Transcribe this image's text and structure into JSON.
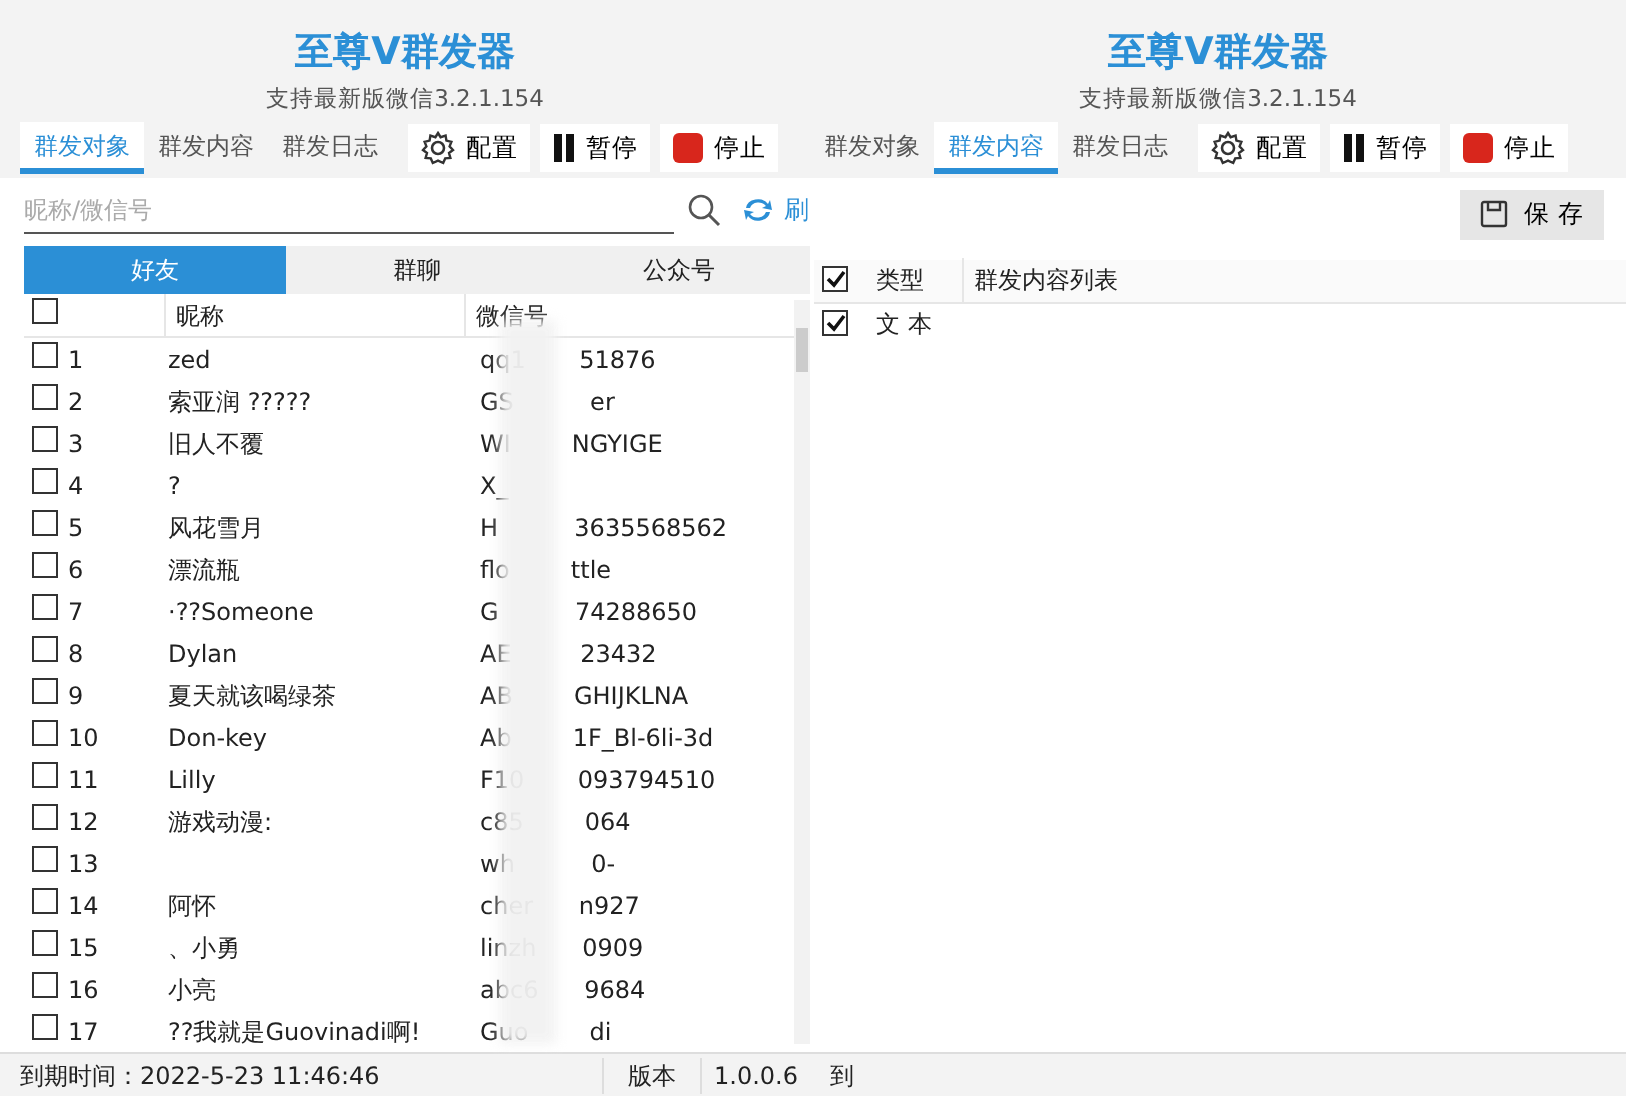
{
  "windows": [
    {
      "title": "至尊V群发器",
      "subtitle": "支持最新版微信3.2.1.154",
      "tabs": [
        {
          "label": "群发对象",
          "selected": true
        },
        {
          "label": "群发内容",
          "selected": false
        },
        {
          "label": "群发日志",
          "selected": false
        }
      ],
      "toolbar": [
        {
          "kind": "gear",
          "label": "配置"
        },
        {
          "kind": "pause",
          "label": "暂停"
        },
        {
          "kind": "stop",
          "label": "停止"
        }
      ],
      "kind": "targets",
      "search": {
        "placeholder": "昵称/微信号",
        "refresh": "刷"
      },
      "segments": [
        {
          "label": "好友",
          "selected": true
        },
        {
          "label": "群聊",
          "selected": false
        },
        {
          "label": "公众号",
          "selected": false
        }
      ],
      "table": {
        "header_checked": false,
        "columns": [
          "昵称",
          "微信号"
        ],
        "rows": [
          {
            "checked": false,
            "index": "1",
            "nickname": "zed",
            "wechat_id": "qq1       51876"
          },
          {
            "checked": false,
            "index": "2",
            "nickname": "索亚润 ?????",
            "wechat_id": "GS          er"
          },
          {
            "checked": false,
            "index": "3",
            "nickname": "旧人不覆",
            "wechat_id": "WI        NGYIGE"
          },
          {
            "checked": false,
            "index": "4",
            "nickname": "?",
            "wechat_id": "X_"
          },
          {
            "checked": false,
            "index": "5",
            "nickname": "风花雪月",
            "wechat_id": "H          3635568562"
          },
          {
            "checked": false,
            "index": "6",
            "nickname": "漂流瓶",
            "wechat_id": "flo        ttle"
          },
          {
            "checked": false,
            "index": "7",
            "nickname": "·??Someone",
            "wechat_id": "G          74288650"
          },
          {
            "checked": false,
            "index": "8",
            "nickname": "Dylan",
            "wechat_id": "AE         23432"
          },
          {
            "checked": false,
            "index": "9",
            "nickname": "夏天就该喝绿茶",
            "wechat_id": "AB        GHIJKLNA"
          },
          {
            "checked": false,
            "index": "10",
            "nickname": "Don-key",
            "wechat_id": "Ab        1F_Bl-6li-3d"
          },
          {
            "checked": false,
            "index": "11",
            "nickname": "Lilly",
            "wechat_id": "F10       093794510"
          },
          {
            "checked": false,
            "index": "12",
            "nickname": "游戏动漫:",
            "wechat_id": "c85        064"
          },
          {
            "checked": false,
            "index": "13",
            "nickname": "",
            "wechat_id": "wh          0-"
          },
          {
            "checked": false,
            "index": "14",
            "nickname": "阿怀",
            "wechat_id": "cher      n927"
          },
          {
            "checked": false,
            "index": "15",
            "nickname": "、小勇",
            "wechat_id": "linzh      0909"
          },
          {
            "checked": false,
            "index": "16",
            "nickname": "小亮",
            "wechat_id": "abc6      9684"
          },
          {
            "checked": false,
            "index": "17",
            "nickname": "??我就是Guovinadi啊!",
            "wechat_id": "Guo        di"
          }
        ]
      },
      "status_bar": {
        "expiry": "到期时间：2022-5-23 11:46:46",
        "version_label": "版本",
        "version": "1.0.0.6"
      }
    },
    {
      "title": "至尊V群发器",
      "subtitle": "支持最新版微信3.2.1.154",
      "tabs": [
        {
          "label": "群发对象",
          "selected": false
        },
        {
          "label": "群发内容",
          "selected": true
        },
        {
          "label": "群发日志",
          "selected": false
        }
      ],
      "toolbar": [
        {
          "kind": "gear",
          "label": "配置"
        },
        {
          "kind": "pause",
          "label": "暂停"
        },
        {
          "kind": "stop",
          "label": "停止"
        }
      ],
      "kind": "content",
      "save_button": "保 存",
      "table": {
        "header_checked": true,
        "columns": [
          "类型",
          "群发内容列表"
        ],
        "rows": [
          {
            "checked": true,
            "type": "文 本"
          }
        ]
      },
      "status_bar": {
        "expiry": "到"
      }
    }
  ]
}
